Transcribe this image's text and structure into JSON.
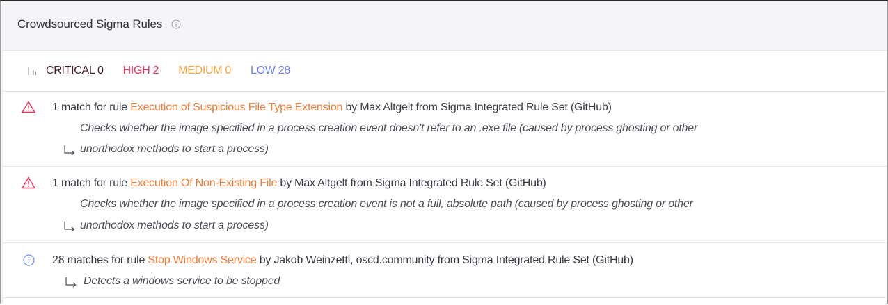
{
  "header": {
    "title": "Crowdsourced Sigma Rules",
    "info_icon": "info-circle-icon"
  },
  "severity": {
    "icon": "bar-chart-icon",
    "critical": "CRITICAL 0",
    "high": "HIGH 2",
    "medium": "MEDIUM 0",
    "low": "LOW 28",
    "colors": {
      "critical": "#4a1e28",
      "high": "#f2325a",
      "medium": "#f5a442",
      "low": "#6d7ef2"
    }
  },
  "rules": [
    {
      "icon": "warning-triangle-icon",
      "prefix": "1 match for rule ",
      "name": "Execution of Suspicious File Type Extension",
      "suffix": " by Max Altgelt from Sigma Integrated Rule Set (GitHub)",
      "desc_line1": "Checks whether the image specified in a process creation event doesn't refer to an .exe file (caused by process ghosting or other",
      "desc_line2": "unorthodox methods to start a process)"
    },
    {
      "icon": "warning-triangle-icon",
      "prefix": "1 match for rule ",
      "name": "Execution Of Non-Existing File",
      "suffix": " by Max Altgelt from Sigma Integrated Rule Set (GitHub)",
      "desc_line1": "Checks whether the image specified in a process creation event is not a full, absolute path (caused by process ghosting or other",
      "desc_line2": "unorthodox methods to start a process)"
    },
    {
      "icon": "info-circle-icon",
      "prefix": "28 matches for rule ",
      "name": "Stop Windows Service",
      "suffix": " by Jakob Weinzettl, oscd.community from Sigma Integrated Rule Set (GitHub)",
      "desc_line1": "Detects a windows service to be stopped"
    }
  ],
  "colors": {
    "link": "#f57c36",
    "warning": "#f2325a",
    "info": "#6d8ef2"
  }
}
